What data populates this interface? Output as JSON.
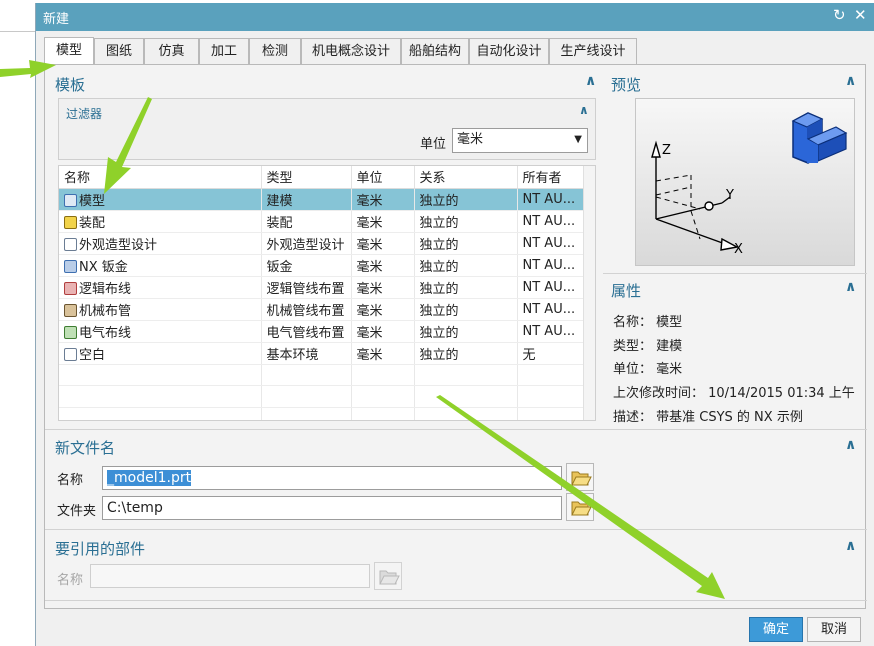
{
  "window": {
    "title": "新建",
    "refresh_glyph": "↻",
    "close_glyph": "✕"
  },
  "tabs": [
    {
      "label": "模型",
      "active": true
    },
    {
      "label": "图纸"
    },
    {
      "label": "仿真"
    },
    {
      "label": "加工"
    },
    {
      "label": "检测"
    },
    {
      "label": "机电概念设计"
    },
    {
      "label": "船舶结构"
    },
    {
      "label": "自动化设计"
    },
    {
      "label": "生产线设计"
    }
  ],
  "template": {
    "title": "模板",
    "filter": {
      "title": "过滤器",
      "unit_label": "单位",
      "unit_value": "毫米"
    },
    "columns": [
      "名称",
      "类型",
      "单位",
      "关系",
      "所有者"
    ],
    "rows": [
      {
        "name": "模型",
        "type": "建模",
        "unit": "毫米",
        "relation": "独立的",
        "owner": "NT AU...",
        "selected": true,
        "icon": "model-file-icon"
      },
      {
        "name": "装配",
        "type": "装配",
        "unit": "毫米",
        "relation": "独立的",
        "owner": "NT AU...",
        "icon": "assembly-file-icon"
      },
      {
        "name": "外观造型设计",
        "type": "外观造型设计",
        "unit": "毫米",
        "relation": "独立的",
        "owner": "NT AU...",
        "icon": "shape-studio-file-icon"
      },
      {
        "name": "NX 钣金",
        "type": "钣金",
        "unit": "毫米",
        "relation": "独立的",
        "owner": "NT AU...",
        "icon": "sheet-metal-file-icon"
      },
      {
        "name": "逻辑布线",
        "type": "逻辑管线布置",
        "unit": "毫米",
        "relation": "独立的",
        "owner": "NT AU...",
        "icon": "logical-routing-file-icon"
      },
      {
        "name": "机械布管",
        "type": "机械管线布置",
        "unit": "毫米",
        "relation": "独立的",
        "owner": "NT AU...",
        "icon": "mechanical-routing-file-icon"
      },
      {
        "name": "电气布线",
        "type": "电气管线布置",
        "unit": "毫米",
        "relation": "独立的",
        "owner": "NT AU...",
        "icon": "electrical-routing-file-icon"
      },
      {
        "name": "空白",
        "type": "基本环境",
        "unit": "毫米",
        "relation": "独立的",
        "owner": "无",
        "icon": "blank-file-icon"
      }
    ]
  },
  "preview": {
    "title": "预览",
    "axis_z": "Z",
    "axis_y": "Y",
    "axis_x": "X"
  },
  "properties": {
    "title": "属性",
    "name": "名称： 模型",
    "type": "类型： 建模",
    "unit": "单位： 毫米",
    "modified": "上次修改时间： 10/14/2015 01:34 上午",
    "description": "描述： 带基准 CSYS 的 NX 示例"
  },
  "new_file": {
    "title": "新文件名",
    "name_label": "名称",
    "name_value": "_model1.prt",
    "folder_label": "文件夹",
    "folder_value": "C:\\temp"
  },
  "referenced_part": {
    "title": "要引用的部件",
    "name_label": "名称",
    "name_value": ""
  },
  "buttons": {
    "ok": "确定",
    "cancel": "取消"
  },
  "colors": {
    "titlebar": "#5aa1bd",
    "selection": "#86c4d6",
    "annotation_arrow": "#8fd12a",
    "section_heading": "#2a6f93"
  }
}
